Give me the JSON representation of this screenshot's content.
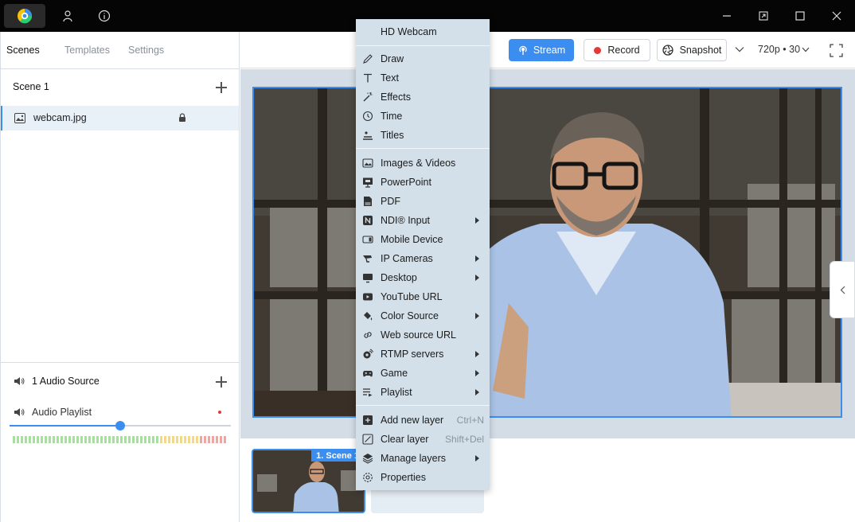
{
  "window": {
    "controls": [
      "minimize-icon",
      "snap-icon",
      "maximize-icon",
      "close-icon"
    ]
  },
  "left": {
    "tabs": [
      {
        "label": "Scenes"
      },
      {
        "label": "Templates"
      },
      {
        "label": "Settings"
      }
    ],
    "scene_title": "Scene 1",
    "layers": [
      {
        "label": "webcam.jpg",
        "locked": true
      }
    ],
    "audio_title": "1 Audio Source",
    "audio_item": "Audio Playlist",
    "audio_level": 0.5
  },
  "toolbar": {
    "stream_label": "Stream",
    "record_label": "Record",
    "snapshot_label": "Snapshot",
    "resolution": "720p • 30"
  },
  "thumbnails": [
    {
      "label": "1. Scene 1"
    }
  ],
  "menu": {
    "header": "HD Webcam",
    "groups": [
      [
        {
          "label": "Draw",
          "icon": "pencil-icon"
        },
        {
          "label": "Text",
          "icon": "text-icon"
        },
        {
          "label": "Effects",
          "icon": "magic-wand-icon"
        },
        {
          "label": "Time",
          "icon": "clock-icon"
        },
        {
          "label": "Titles",
          "icon": "titles-icon"
        }
      ],
      [
        {
          "label": "Images & Videos",
          "icon": "image-icon"
        },
        {
          "label": "PowerPoint",
          "icon": "powerpoint-icon"
        },
        {
          "label": "PDF",
          "icon": "pdf-icon"
        },
        {
          "label": "NDI® Input",
          "icon": "ndi-icon",
          "submenu": true
        },
        {
          "label": "Mobile Device",
          "icon": "mobile-device-icon"
        },
        {
          "label": "IP Cameras",
          "icon": "ip-camera-icon",
          "submenu": true
        },
        {
          "label": "Desktop",
          "icon": "desktop-icon",
          "submenu": true
        },
        {
          "label": "YouTube URL",
          "icon": "youtube-icon"
        },
        {
          "label": "Color Source",
          "icon": "paint-bucket-icon",
          "submenu": true
        },
        {
          "label": "Web source URL",
          "icon": "link-icon"
        },
        {
          "label": "RTMP servers",
          "icon": "rtmp-icon",
          "submenu": true
        },
        {
          "label": "Game",
          "icon": "gamepad-icon",
          "submenu": true
        },
        {
          "label": "Playlist",
          "icon": "playlist-icon",
          "submenu": true
        }
      ],
      [
        {
          "label": "Add new layer",
          "icon": "add-layer-icon",
          "shortcut": "Ctrl+N"
        },
        {
          "label": "Clear layer",
          "icon": "clear-layer-icon",
          "shortcut": "Shift+Del"
        },
        {
          "label": "Manage layers",
          "icon": "layers-icon",
          "submenu": true
        },
        {
          "label": "Properties",
          "icon": "gear-icon"
        }
      ]
    ]
  },
  "colors": {
    "accent": "#3b8ef0",
    "record": "#e53935",
    "menu_bg": "#d3e0ea",
    "titlebar": "#050505"
  }
}
